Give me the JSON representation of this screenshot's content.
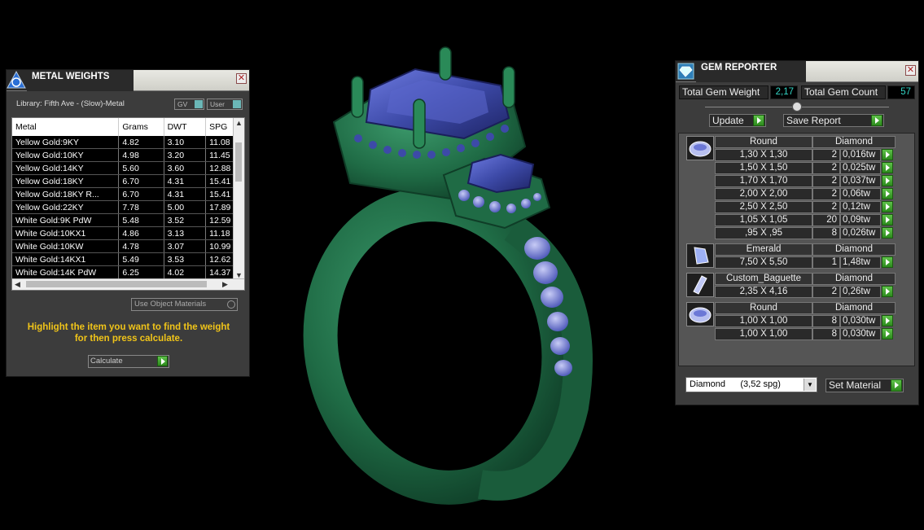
{
  "metal_weights": {
    "title": "METAL WEIGHTS",
    "library_label": "Library: Fifth Ave - (Slow)-Metal",
    "dropdown_gv": "GV",
    "dropdown_user": "User",
    "columns": [
      "Metal",
      "Grams",
      "DWT",
      "SPG"
    ],
    "rows": [
      [
        "Yellow Gold:9KY",
        "4.82",
        "3.10",
        "11.08"
      ],
      [
        "Yellow Gold:10KY",
        "4.98",
        "3.20",
        "11.45"
      ],
      [
        "Yellow Gold:14KY",
        "5.60",
        "3.60",
        "12.88"
      ],
      [
        "Yellow Gold:18KY",
        "6.70",
        "4.31",
        "15.41"
      ],
      [
        "Yellow Gold:18KY R...",
        "6.70",
        "4.31",
        "15.41"
      ],
      [
        "Yellow Gold:22KY",
        "7.78",
        "5.00",
        "17.89"
      ],
      [
        "White Gold:9K PdW",
        "5.48",
        "3.52",
        "12.59"
      ],
      [
        "White Gold:10KX1",
        "4.86",
        "3.13",
        "11.18"
      ],
      [
        "White Gold:10KW",
        "4.78",
        "3.07",
        "10.99"
      ],
      [
        "White Gold:14KX1",
        "5.49",
        "3.53",
        "12.62"
      ],
      [
        "White Gold:14K PdW",
        "6.25",
        "4.02",
        "14.37"
      ]
    ],
    "use_object_materials": "Use Object Materials",
    "hint_line1": "Highlight the item you want to find the weight",
    "hint_line2": "for then press calculate.",
    "calculate_label": "Calculate"
  },
  "gem_reporter": {
    "title": "GEM REPORTER",
    "total_weight_label": "Total Gem Weight",
    "total_weight_value": "2,17",
    "total_count_label": "Total Gem Count",
    "total_count_value": "57",
    "update_label": "Update",
    "save_report_label": "Save Report",
    "groups": [
      {
        "shape": "Round",
        "material": "Diamond",
        "rows": [
          [
            "1,30 X 1,30",
            "2",
            "0,016tw"
          ],
          [
            "1,50 X 1,50",
            "2",
            "0,025tw"
          ],
          [
            "1,70 X 1,70",
            "2",
            "0,037tw"
          ],
          [
            "2,00 X 2,00",
            "2",
            "0,06tw"
          ],
          [
            "2,50 X 2,50",
            "2",
            "0,12tw"
          ],
          [
            "1,05 X 1,05",
            "20",
            "0,09tw"
          ],
          [
            ",95 X ,95",
            "8",
            "0,026tw"
          ]
        ]
      },
      {
        "shape": "Emerald",
        "material": "Diamond",
        "rows": [
          [
            "7,50 X 5,50",
            "1",
            "1,48tw"
          ]
        ]
      },
      {
        "shape": "Custom_Baguette",
        "material": "Diamond",
        "rows": [
          [
            "2,35 X 4,16",
            "2",
            "0,26tw"
          ]
        ]
      },
      {
        "shape": "Round",
        "material": "Diamond",
        "rows": [
          [
            "1,00 X 1,00",
            "8",
            "0,030tw"
          ],
          [
            "1,00 X 1,00",
            "8",
            "0,030tw"
          ]
        ]
      }
    ],
    "material_select": "Diamond      (3,52 spg)",
    "set_material_label": "Set Material"
  },
  "colors": {
    "ring_metal": "#1f6b45",
    "gem_blue": "#3d4aa8",
    "hint_yellow": "#f0c419",
    "accent_green": "#3da62a",
    "value_cyan": "#33d6c6"
  }
}
